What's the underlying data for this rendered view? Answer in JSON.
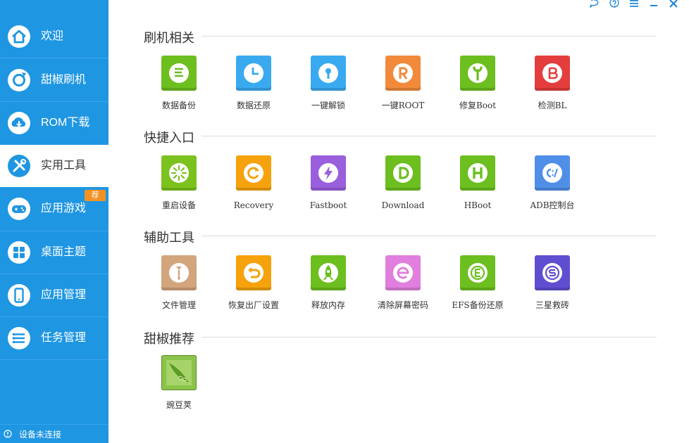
{
  "sidebar": {
    "items": [
      {
        "label": "欢迎",
        "icon": "home-icon"
      },
      {
        "label": "甜椒刷机",
        "icon": "refresh-icon"
      },
      {
        "label": "ROM下载",
        "icon": "cloud-download-icon"
      },
      {
        "label": "实用工具",
        "icon": "tools-icon",
        "active": true
      },
      {
        "label": "应用游戏",
        "icon": "gamepad-icon",
        "badge": "荐"
      },
      {
        "label": "桌面主题",
        "icon": "grid-icon"
      },
      {
        "label": "应用管理",
        "icon": "phone-icon"
      },
      {
        "label": "任务管理",
        "icon": "list-icon"
      }
    ],
    "status": "设备未连接"
  },
  "sections": [
    {
      "title": "刷机相关",
      "tools": [
        {
          "label": "数据备份",
          "icon": "backup-icon",
          "color": "#6cbf1f"
        },
        {
          "label": "数据还原",
          "icon": "clock-icon",
          "color": "#3aaaf0"
        },
        {
          "label": "一键解锁",
          "icon": "key-icon",
          "color": "#3aaaf0"
        },
        {
          "label": "一键ROOT",
          "icon": "root-r-icon",
          "color": "#f28a3c"
        },
        {
          "label": "修复Boot",
          "icon": "wrench-icon",
          "color": "#6cbf1f"
        },
        {
          "label": "检测BL",
          "icon": "bl-b-icon",
          "color": "#e43d3d"
        }
      ]
    },
    {
      "title": "快捷入口",
      "tools": [
        {
          "label": "重启设备",
          "icon": "restart-icon",
          "color": "#7cc21e"
        },
        {
          "label": "Recovery",
          "icon": "recovery-icon",
          "color": "#f5a20c"
        },
        {
          "label": "Fastboot",
          "icon": "bolt-icon",
          "color": "#9a5fdc"
        },
        {
          "label": "Download",
          "icon": "download-d-icon",
          "color": "#6cbf1f"
        },
        {
          "label": "HBoot",
          "icon": "hboot-h-icon",
          "color": "#6cbf1f"
        },
        {
          "label": "ADB控制台",
          "icon": "console-icon",
          "color": "#4f8fe8"
        }
      ]
    },
    {
      "title": "辅助工具",
      "tools": [
        {
          "label": "文件管理",
          "icon": "file-icon",
          "color": "#d3a57c"
        },
        {
          "label": "恢复出厂设置",
          "icon": "reset-icon",
          "color": "#f5a20c"
        },
        {
          "label": "释放内存",
          "icon": "rocket-icon",
          "color": "#6cbf1f"
        },
        {
          "label": "清除屏幕密码",
          "icon": "erase-icon",
          "color": "#e07fdd"
        },
        {
          "label": "EFS备份还原",
          "icon": "efs-icon",
          "color": "#6cbf1f"
        },
        {
          "label": "三星救砖",
          "icon": "samsung-icon",
          "color": "#5f4fd0"
        }
      ]
    },
    {
      "title": "甜椒推荐",
      "tools": [
        {
          "label": "豌豆荚",
          "icon": "peapod-icon",
          "color": "#8cc34a"
        }
      ]
    }
  ],
  "titlebar": {
    "buttons": [
      "chat-icon",
      "help-icon",
      "menu-icon",
      "minimize-icon",
      "close-icon"
    ]
  }
}
